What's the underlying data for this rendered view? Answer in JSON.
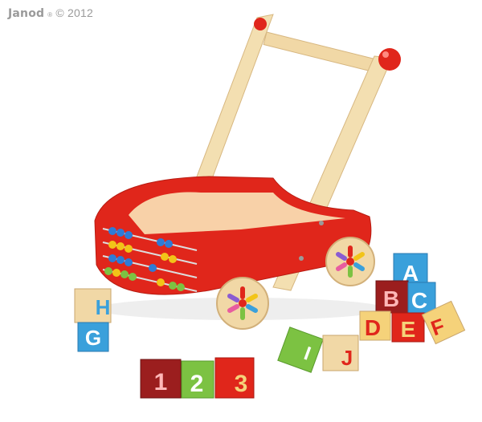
{
  "brand": {
    "logo_text": "Janod",
    "registered_mark": "®",
    "copyright": "© 2012"
  },
  "colors": {
    "cart_red": "#e0261b",
    "wood_light": "#f1d8a6",
    "wood_mid": "#e6c48b",
    "knob_red": "#e0261b",
    "abacus_blue": "#2e7bd6",
    "abacus_yellow": "#f2c418",
    "abacus_green": "#7cc242"
  },
  "blocks": {
    "h_block": "H",
    "g_block": "G",
    "one_block": "1",
    "two_block": "2",
    "three_block": "3",
    "a_block": "A",
    "b_block": "B",
    "c_block": "C",
    "d_block": "D",
    "e_block": "E",
    "f_block": "F",
    "i_block": "I",
    "j_block": "J"
  }
}
